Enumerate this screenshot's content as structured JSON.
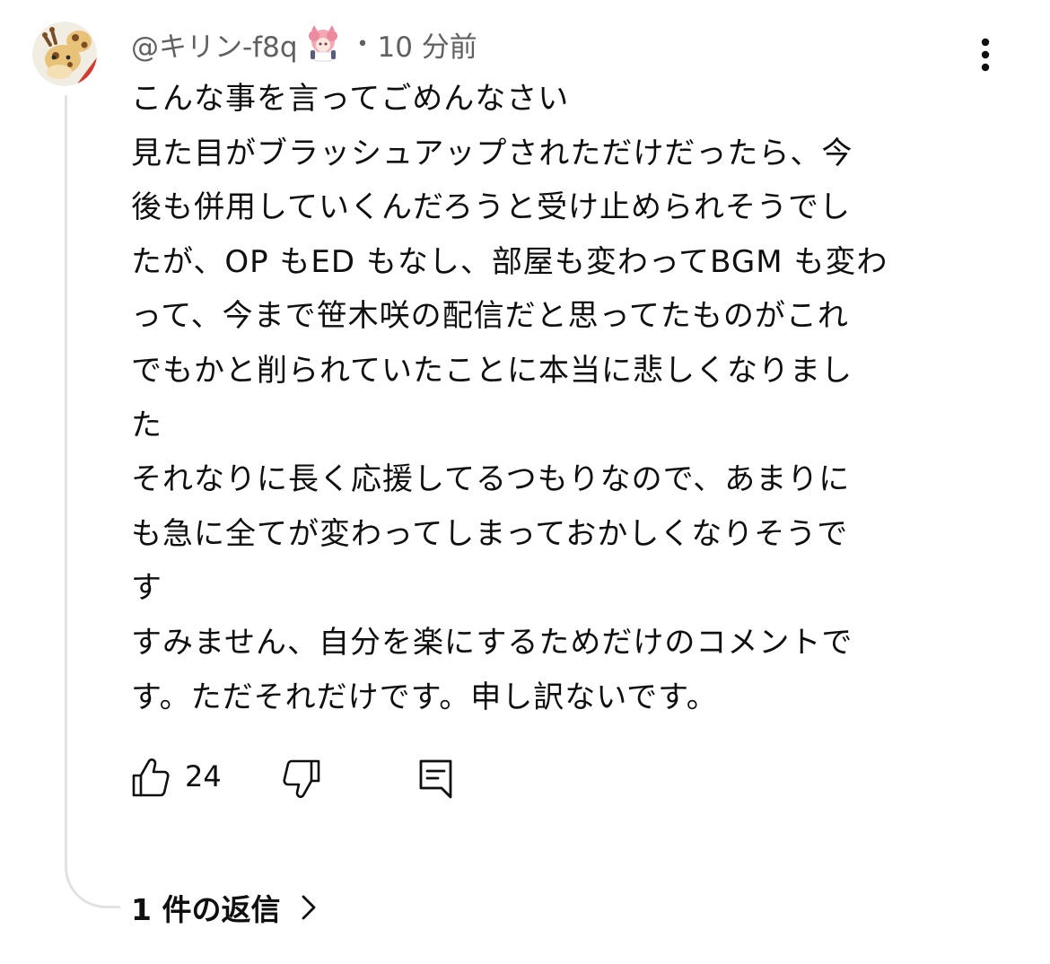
{
  "comment": {
    "author": "@キリン-f8q",
    "separator": "•",
    "timestamp": "10 分前",
    "lines": [
      "こんな事を言ってごめんなさい",
      "見た目がブラッシュアップされただけだったら、今",
      "後も併用していくんだろうと受け止められそうでし",
      "たが、OP もED もなし、部屋も変わってBGM も変わ",
      "って、今まで笹木咲の配信だと思ってたものがこれ",
      "でもかと削られていたことに本当に悲しくなりまし",
      "た",
      "それなりに長く応援してるつもりなので、あまりに",
      "も急に全てが変わってしまっておかしくなりそうで",
      "す",
      "すみません、自分を楽にするためだけのコメントで",
      "す。ただそれだけです。申し訳ないです。"
    ],
    "like_count": "24",
    "replies_label": "1 件の返信"
  },
  "icons": {
    "avatar": "giraffe-avatar-icon",
    "badge": "member-badge-icon",
    "menu": "more-vert-icon",
    "like": "thumb-up-icon",
    "dislike": "thumb-down-icon",
    "reply": "comment-reply-icon",
    "expand": "chevron-right-icon"
  },
  "colors": {
    "text_primary": "#0f0f0f",
    "text_secondary": "#606060",
    "thread_line": "#e2e2e2"
  }
}
